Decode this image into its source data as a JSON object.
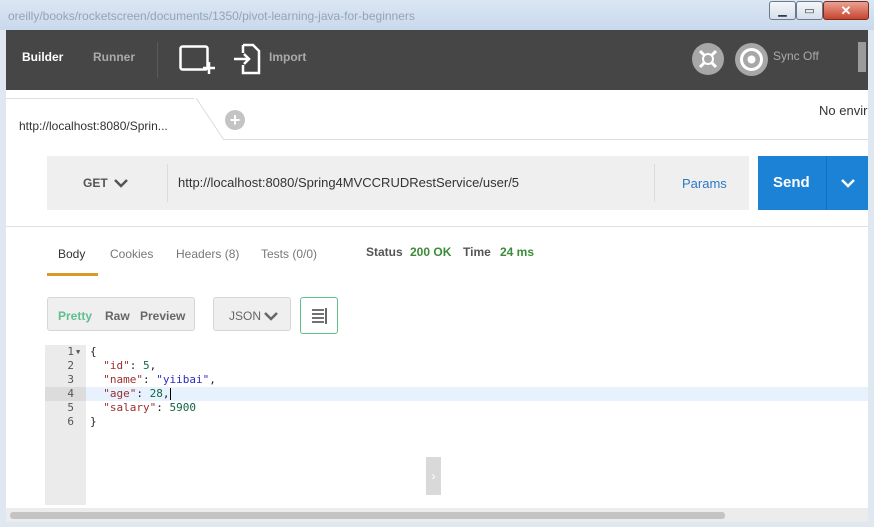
{
  "window": {
    "title": "oreilly/books/rocketscreen/documents/1350/pivot-learning-java-for-beginners",
    "minimize_label": "▁",
    "maximize_label": "▭",
    "close_label": "✕"
  },
  "toolbar": {
    "builder_label": "Builder",
    "runner_label": "Runner",
    "import_label": "Import",
    "sync_label": "Sync Off",
    "new_icon": "new-window-icon",
    "import_icon": "import-icon",
    "icon1": "interceptor-icon",
    "icon2": "sync-icon"
  },
  "tabs": {
    "active_label": "http://localhost:8080/Sprin...",
    "add_label": "+",
    "environment_label": "No envir"
  },
  "request": {
    "method": "GET",
    "url": "http://localhost:8080/Spring4MVCCRUDRestService/user/5",
    "params_label": "Params",
    "send_label": "Send"
  },
  "response": {
    "tabs": [
      {
        "label": "Body"
      },
      {
        "label": "Cookies"
      },
      {
        "label": "Headers (8)"
      },
      {
        "label": "Tests (0/0)"
      }
    ],
    "status_label": "Status",
    "status_value": "200 OK",
    "time_label": "Time",
    "time_value": "24 ms",
    "view_options": [
      "Pretty",
      "Raw",
      "Preview"
    ],
    "format": "JSON",
    "collapse_label": "›"
  },
  "code_lines": [
    {
      "num": "1",
      "text": "{"
    },
    {
      "num": "2",
      "key": "\"id\"",
      "sep": ": ",
      "val": "5",
      "tail": ","
    },
    {
      "num": "3",
      "key": "\"name\"",
      "sep": ": ",
      "val": "\"yiibai\"",
      "tail": ","
    },
    {
      "num": "4",
      "key": "\"age\"",
      "sep": ": ",
      "val": "28",
      "tail": ","
    },
    {
      "num": "5",
      "key": "\"salary\"",
      "sep": ": ",
      "val": "5900",
      "tail": ""
    },
    {
      "num": "6",
      "text": "}"
    }
  ],
  "colors": {
    "topbar": "#464646",
    "send": "#1b82d6",
    "accent_green": "#5fbf8f",
    "status_green": "#3b8b3b",
    "tab_underline": "#d99a2b"
  }
}
